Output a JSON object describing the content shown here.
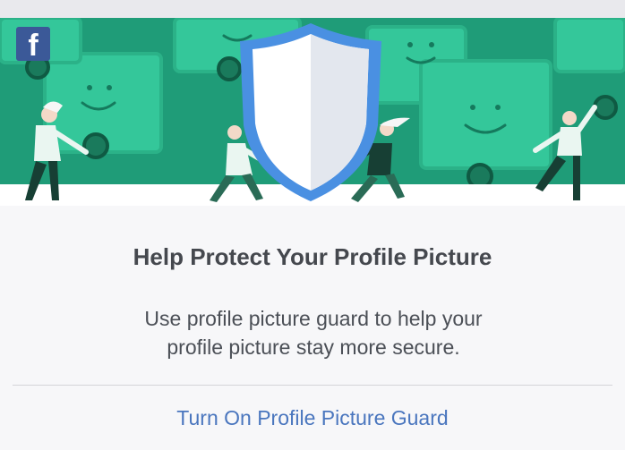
{
  "app": {
    "brand_icon": "facebook-logo-icon",
    "brand_glyph": "f"
  },
  "hero": {
    "illustration": "profile-picture-guard-illustration",
    "colors": {
      "background": "#1f9c78",
      "frames": "#34c79a",
      "shield_border": "#4a90e2",
      "shield_fill": "#f2f4f7"
    }
  },
  "content": {
    "title": "Help Protect Your Profile Picture",
    "description_line1": "Use profile picture guard to help your",
    "description_line2": "profile picture stay more secure."
  },
  "actions": {
    "primary_label": "Turn On Profile Picture Guard",
    "primary_color": "#4a76be"
  }
}
